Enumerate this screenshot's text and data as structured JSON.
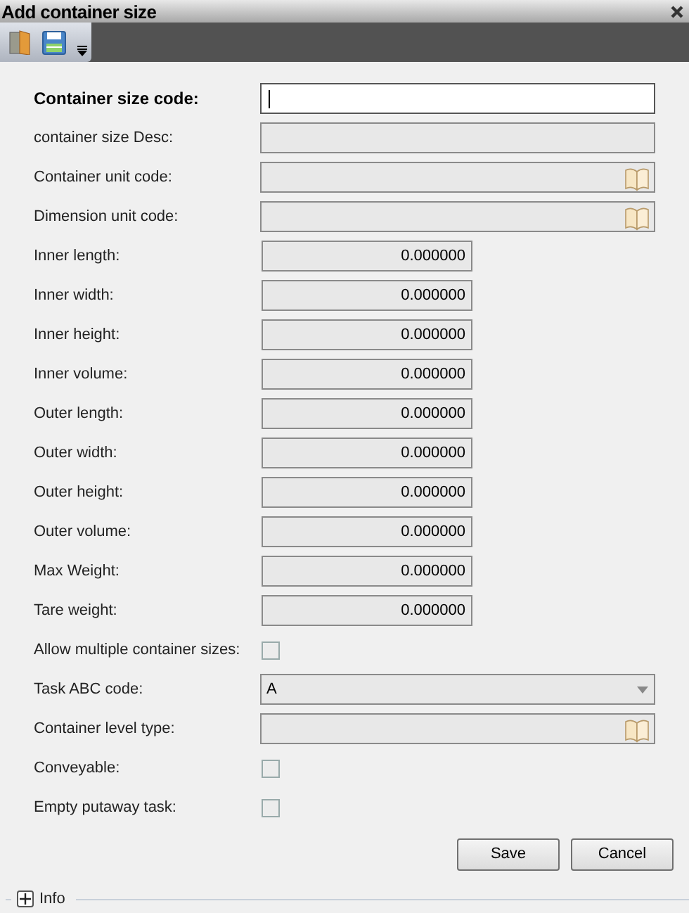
{
  "window": {
    "title": "Add container size"
  },
  "fields": [
    {
      "kind": "text",
      "label": "Container size code:",
      "bold": true,
      "disabled": false
    },
    {
      "kind": "text",
      "label": "container size Desc:",
      "bold": false,
      "disabled": true
    },
    {
      "kind": "lookup",
      "label": "Container unit code:",
      "bold": false,
      "disabled": true
    },
    {
      "kind": "lookup",
      "label": "Dimension unit code:",
      "bold": false,
      "disabled": true
    },
    {
      "kind": "number",
      "label": "Inner length:",
      "bold": false,
      "disabled": true,
      "value": "0.000000"
    },
    {
      "kind": "number",
      "label": "Inner width:",
      "bold": false,
      "disabled": true,
      "value": "0.000000"
    },
    {
      "kind": "number",
      "label": "Inner height:",
      "bold": false,
      "disabled": true,
      "value": "0.000000"
    },
    {
      "kind": "number",
      "label": "Inner volume:",
      "bold": false,
      "disabled": true,
      "value": "0.000000"
    },
    {
      "kind": "number",
      "label": "Outer length:",
      "bold": false,
      "disabled": true,
      "value": "0.000000"
    },
    {
      "kind": "number",
      "label": "Outer width:",
      "bold": false,
      "disabled": true,
      "value": "0.000000"
    },
    {
      "kind": "number",
      "label": "Outer height:",
      "bold": false,
      "disabled": true,
      "value": "0.000000"
    },
    {
      "kind": "number",
      "label": "Outer volume:",
      "bold": false,
      "disabled": true,
      "value": "0.000000"
    },
    {
      "kind": "number",
      "label": "Max Weight:",
      "bold": false,
      "disabled": true,
      "value": "0.000000"
    },
    {
      "kind": "number",
      "label": "Tare weight:",
      "bold": false,
      "disabled": true,
      "value": "0.000000"
    },
    {
      "kind": "checkbox",
      "label": "Allow multiple container sizes:",
      "bold": false,
      "disabled": true,
      "checked": false
    },
    {
      "kind": "select",
      "label": "Task ABC code:",
      "bold": false,
      "disabled": true,
      "value": "A"
    },
    {
      "kind": "lookup",
      "label": "Container level type:",
      "bold": false,
      "disabled": true
    },
    {
      "kind": "checkbox",
      "label": "Conveyable:",
      "bold": false,
      "disabled": true,
      "checked": false
    },
    {
      "kind": "checkbox",
      "label": "Empty putaway task:",
      "bold": false,
      "disabled": true,
      "checked": false
    }
  ],
  "buttons": [
    "Save",
    "Cancel"
  ],
  "info": {
    "label": "Info",
    "expanded": false
  }
}
